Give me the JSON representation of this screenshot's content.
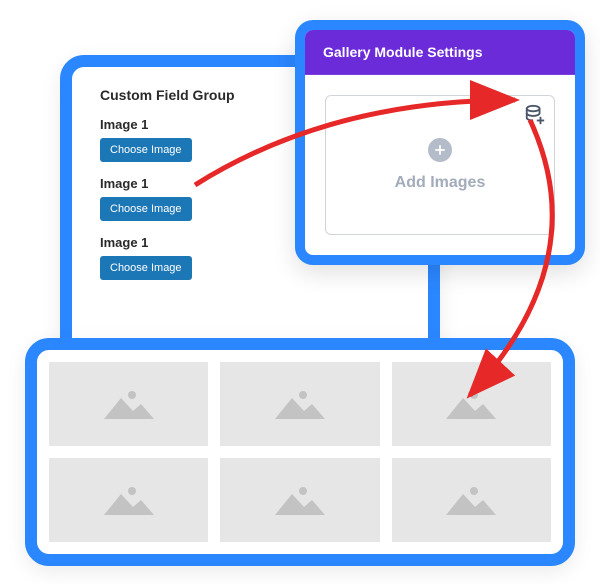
{
  "left_panel": {
    "title": "Custom Field Group",
    "fields": [
      {
        "label": "Image 1",
        "button": "Choose Image"
      },
      {
        "label": "Image 1",
        "button": "Choose Image"
      },
      {
        "label": "Image 1",
        "button": "Choose Image"
      }
    ]
  },
  "gallery_panel": {
    "header": "Gallery Module Settings",
    "add_label": "Add Images"
  },
  "colors": {
    "primary_blue": "#2b87ff",
    "purple": "#6c2bd9",
    "button_blue": "#1c77b6",
    "arrow_red": "#e62828"
  }
}
